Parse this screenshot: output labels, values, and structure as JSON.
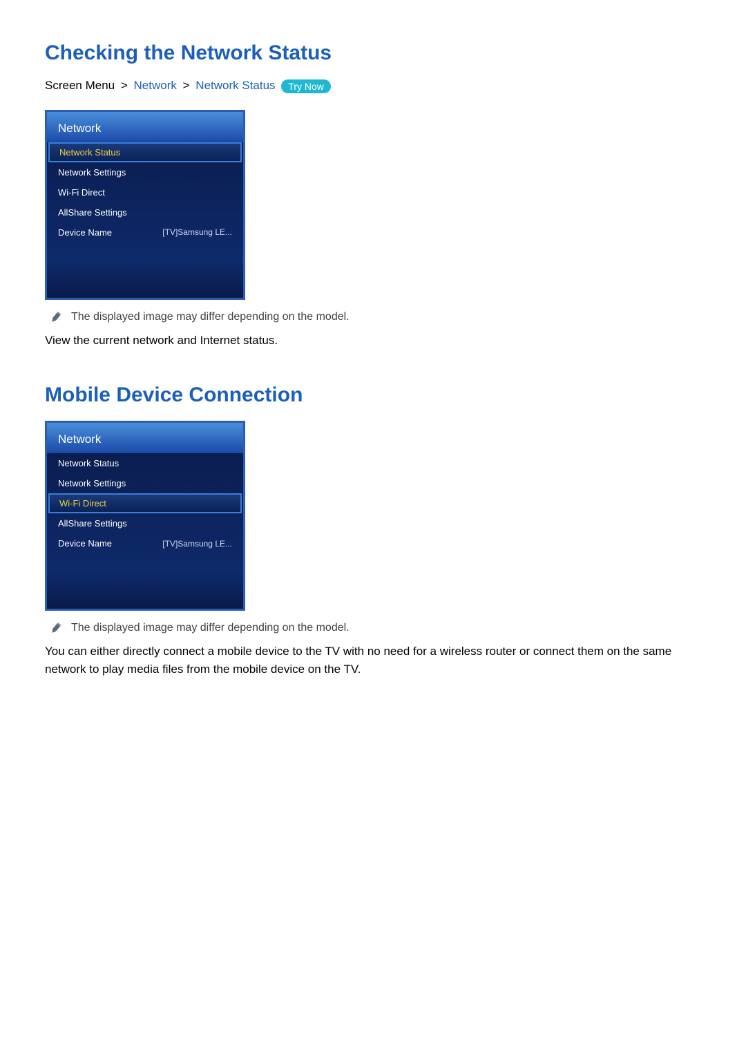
{
  "section1": {
    "title": "Checking the Network Status",
    "breadcrumb": {
      "prefix": "Screen Menu",
      "sep": ">",
      "link1": "Network",
      "link2": "Network Status",
      "try_now": "Try Now"
    },
    "panel": {
      "header": "Network",
      "items": [
        {
          "label": "Network Status",
          "value": ""
        },
        {
          "label": "Network Settings",
          "value": ""
        },
        {
          "label": "Wi-Fi Direct",
          "value": ""
        },
        {
          "label": "AllShare Settings",
          "value": ""
        },
        {
          "label": "Device Name",
          "value": "[TV]Samsung LE..."
        }
      ],
      "selected_index": 0
    },
    "note": "The displayed image may differ depending on the model.",
    "body": "View the current network and Internet status."
  },
  "section2": {
    "title": "Mobile Device Connection",
    "panel": {
      "header": "Network",
      "items": [
        {
          "label": "Network Status",
          "value": ""
        },
        {
          "label": "Network Settings",
          "value": ""
        },
        {
          "label": "Wi-Fi Direct",
          "value": ""
        },
        {
          "label": "AllShare Settings",
          "value": ""
        },
        {
          "label": "Device Name",
          "value": "[TV]Samsung LE..."
        }
      ],
      "selected_index": 2
    },
    "note": "The displayed image may differ depending on the model.",
    "body": "You can either directly connect a mobile device to the TV with no need for a wireless router or connect them on the same network to play media files from the mobile device on the TV."
  }
}
